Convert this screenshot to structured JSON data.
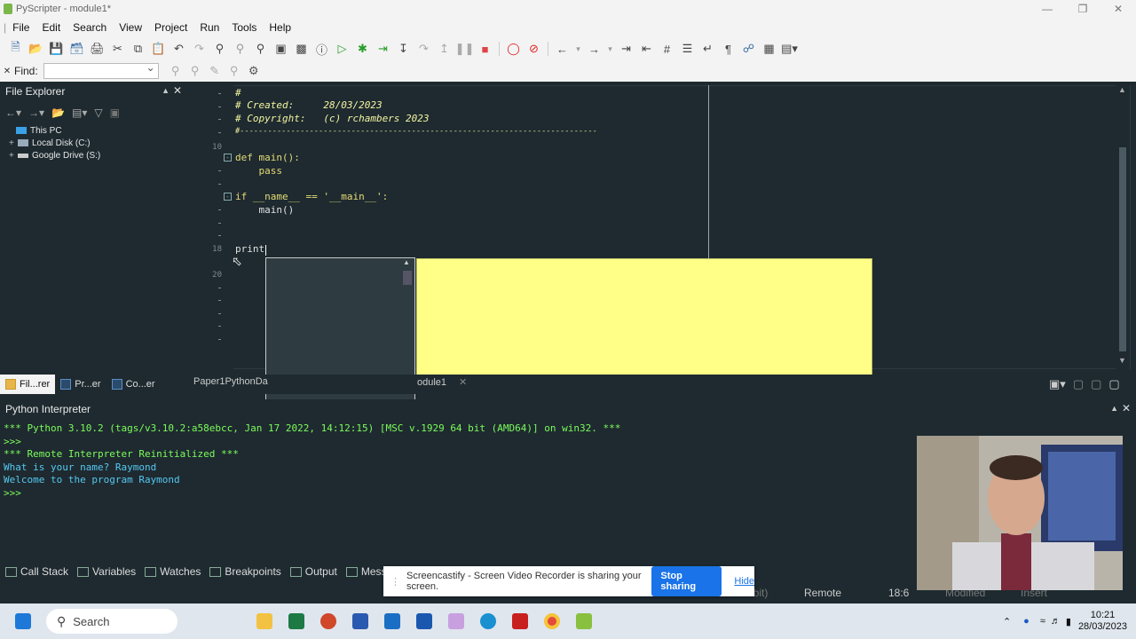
{
  "window": {
    "title": "PyScripter - module1*"
  },
  "menu": [
    "File",
    "Edit",
    "Search",
    "View",
    "Project",
    "Run",
    "Tools",
    "Help"
  ],
  "find": {
    "label": "Find:",
    "value": ""
  },
  "file_explorer": {
    "title": "File Explorer",
    "tree": [
      {
        "label": "This PC",
        "expanded": true
      },
      {
        "label": "Local Disk (C:)",
        "expanded": false
      },
      {
        "label": "Google Drive (S:)",
        "expanded": false
      }
    ]
  },
  "editor": {
    "line_numbers": {
      "l10": "10",
      "l18": "18",
      "l20": "20"
    },
    "lines": {
      "c1": "#",
      "c2": "# Created:     28/03/2023",
      "c3": "# Copyright:   (c) rchambers 2023",
      "c4": "#-----------------------------------------------------------------------------",
      "c6": "def main():",
      "c7": "    pass",
      "c9": "if __name__ == '__main__':",
      "c10": "    main()",
      "c13": "print"
    }
  },
  "tabs": {
    "left": [
      {
        "label": "Fil...rer",
        "active": true
      },
      {
        "label": "Pr...er",
        "active": false
      },
      {
        "label": "Co...er",
        "active": false
      }
    ],
    "editor_tab1": "Paper1PythonDa",
    "editor_tab2": "odule1"
  },
  "interpreter": {
    "title": "Python Interpreter",
    "lines": [
      {
        "text": "*** Python 3.10.2 (tags/v3.10.2:a58ebcc, Jan 17 2022, 14:12:15) [MSC v.1929 64 bit (AMD64)] on win32. ***",
        "color": "green"
      },
      {
        "text": ">>>",
        "color": "green"
      },
      {
        "text": "*** Remote Interpreter Reinitialized ***",
        "color": "green"
      },
      {
        "text": "What is your name? Raymond",
        "color": "cyan"
      },
      {
        "text": "Welcome to the program Raymond",
        "color": "cyan"
      },
      {
        "text": ">>>",
        "color": "green"
      }
    ]
  },
  "bottom_tabs": [
    "Call Stack",
    "Variables",
    "Watches",
    "Breakpoints",
    "Output",
    "Mess"
  ],
  "status": {
    "bits": "4-bit)",
    "mode": "Remote",
    "position": "18:6",
    "modified": "Modified",
    "insert": "Insert"
  },
  "share_bar": {
    "message": "Screencastify - Screen Video Recorder is sharing your screen.",
    "stop_label": "Stop sharing",
    "hide_label": "Hide"
  },
  "taskbar": {
    "search": "Search",
    "time": "10:21",
    "date": "28/03/2023"
  }
}
